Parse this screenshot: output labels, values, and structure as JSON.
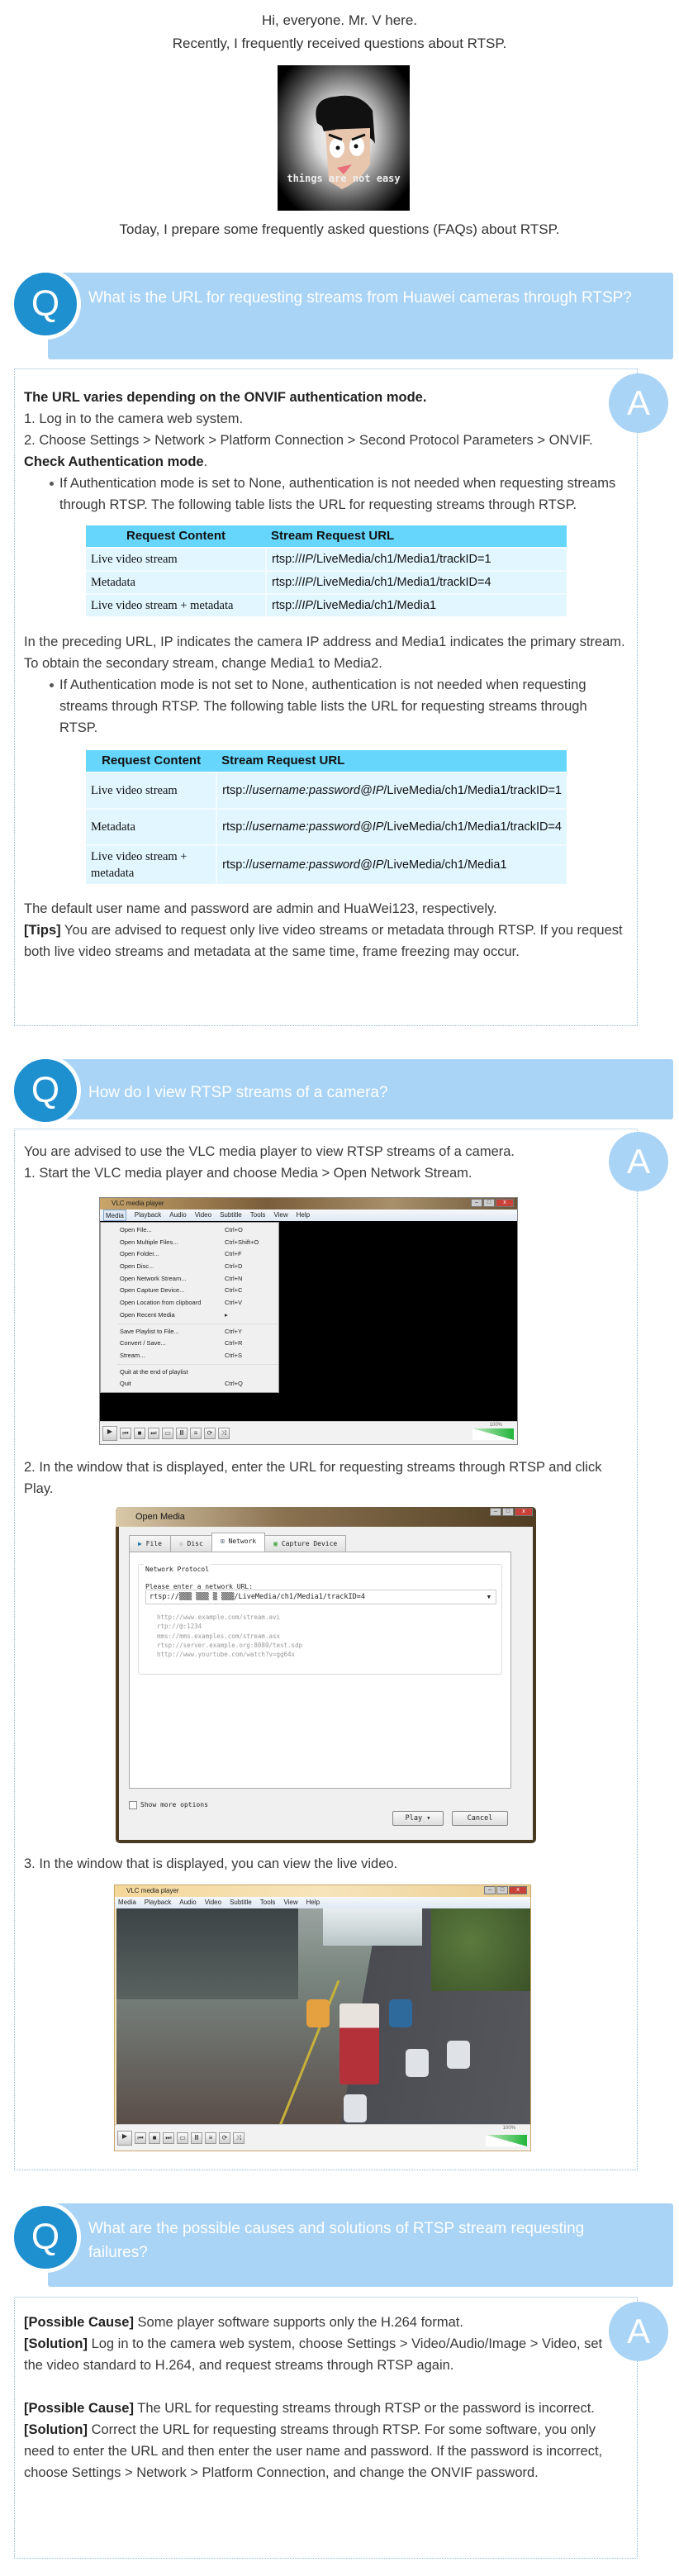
{
  "intro": {
    "line1": "Hi, everyone. Mr. V here.",
    "line2": "Recently, I frequently received questions about RTSP.",
    "image_caption": "things are not easy",
    "line3": "Today, I prepare some frequently asked questions (FAQs) about RTSP."
  },
  "badges": {
    "q": "Q",
    "a": "A"
  },
  "colors": {
    "question_bar": "#a9d4f6",
    "q_circle": "#1e8fcf",
    "a_circle": "#a9d4f6",
    "table_header": "#66d6fc",
    "table_row": "#e1f6fe"
  },
  "faq1": {
    "question": "What is the URL for requesting streams from Huawei cameras through RTSP?",
    "intro_bold": "The URL varies depending on the ONVIF authentication mode.",
    "step1": "1. Log in to the camera web system.",
    "step2_text": "2. Choose Settings > Network > Platform Connection > Second Protocol Parameters > ONVIF. ",
    "step2_bold": "Check Authentication mode",
    "step2_end": ".",
    "bullet1": "If Authentication mode is set to None, authentication is not needed when requesting streams through RTSP. The following table lists the URL for requesting streams through RTSP.",
    "table1": {
      "headers": [
        "Request Content",
        "Stream Request URL"
      ],
      "rows": [
        {
          "content": "Live video stream",
          "url_pre": "rtsp://",
          "url_var": "IP",
          "url_post": "/LiveMedia/ch1/Media1/trackID=1"
        },
        {
          "content": "Metadata",
          "url_pre": "rtsp://",
          "url_var": "IP",
          "url_post": "/LiveMedia/ch1/Media1/trackID=4"
        },
        {
          "content": "Live video stream + metadata",
          "url_pre": "rtsp://",
          "url_var": "IP",
          "url_post": "/LiveMedia/ch1/Media1"
        }
      ]
    },
    "note": "In the preceding URL, IP indicates the camera IP address and Media1 indicates the primary stream. To obtain the secondary stream, change Media1 to Media2.",
    "bullet2": "If Authentication mode is not set to None, authentication is not needed when requesting streams through RTSP. The following table lists the URL for requesting streams through RTSP.",
    "table2": {
      "headers": [
        "Request Content",
        "Stream Request URL"
      ],
      "rows": [
        {
          "content": "Live video stream",
          "url_pre": "rtsp://",
          "url_var": "username:password@IP",
          "url_post": "/LiveMedia/ch1/Media1/trackID=1"
        },
        {
          "content": "Metadata",
          "url_pre": "rtsp://",
          "url_var": "username:password@IP",
          "url_post": "/LiveMedia/ch1/Media1/trackID=4"
        },
        {
          "content": "Live video stream + metadata",
          "url_pre": "rtsp://",
          "url_var": "username:password@IP",
          "url_post": "/LiveMedia/ch1/Media1"
        }
      ]
    },
    "default_creds": "The default user name and password are admin and HuaWei123, respectively.",
    "tips_label": "[Tips]",
    "tips_text": " You are advised to request only live video streams or metadata through RTSP. If you request both live video streams and metadata at the same time, frame freezing may occur."
  },
  "faq2": {
    "question": "How do I view RTSP streams of a camera?",
    "intro": "You are advised to use the VLC media player to view RTSP streams of a camera.",
    "step1": "1. Start the VLC media player and choose Media > Open Network Stream.",
    "step2": "2. In the window that is displayed, enter the URL for requesting streams through RTSP and click Play.",
    "step3": "3. In the window that is displayed, you can view the live video.",
    "vlc": {
      "title": "VLC media player",
      "menus": [
        "Media",
        "Playback",
        "Audio",
        "Video",
        "Subtitle",
        "Tools",
        "View",
        "Help"
      ],
      "media_menu": [
        {
          "label": "Open File...",
          "shortcut": "Ctrl+O"
        },
        {
          "label": "Open Multiple Files...",
          "shortcut": "Ctrl+Shift+O"
        },
        {
          "label": "Open Folder...",
          "shortcut": "Ctrl+F"
        },
        {
          "label": "Open Disc...",
          "shortcut": "Ctrl+D"
        },
        {
          "label": "Open Network Stream...",
          "shortcut": "Ctrl+N"
        },
        {
          "label": "Open Capture Device...",
          "shortcut": "Ctrl+C"
        },
        {
          "label": "Open Location from clipboard",
          "shortcut": "Ctrl+V"
        },
        {
          "label": "Open Recent Media",
          "shortcut": "▸"
        },
        {
          "label": "Save Playlist to File...",
          "shortcut": "Ctrl+Y"
        },
        {
          "label": "Convert / Save...",
          "shortcut": "Ctrl+R"
        },
        {
          "label": "Stream...",
          "shortcut": "Ctrl+S"
        },
        {
          "label": "Quit at the end of playlist",
          "shortcut": ""
        },
        {
          "label": "Quit",
          "shortcut": "Ctrl+Q"
        }
      ],
      "volume": "100%"
    },
    "open_media": {
      "title": "Open Media",
      "tabs": [
        "File",
        "Disc",
        "Network",
        "Capture Device"
      ],
      "active_tab": "Network",
      "group_label": "Network Protocol",
      "prompt": "Please enter a network URL:",
      "url_value": "rtsp://▒▒▒ ▒▒▒ ▒ ▒▒▒/LiveMedia/ch1/Media1/trackID=4",
      "examples": [
        "http://www.example.com/stream.avi",
        "rtp://@:1234",
        "mms://mms.examples.com/stream.asx",
        "rtsp://server.example.org:8080/test.sdp",
        "http://www.yourtube.com/watch?v=gg64x"
      ],
      "show_more": "Show more options",
      "play": "Play",
      "cancel": "Cancel"
    }
  },
  "faq3": {
    "question": "What are the possible causes and solutions of RTSP stream requesting failures?",
    "cause_label": "[Possible Cause]",
    "solution_label": "[Solution]",
    "cause1": " Some player software supports only the H.264 format.",
    "solution1": " Log in to the camera web system, choose Settings > Video/Audio/Image > Video, set the video standard to H.264, and request streams through RTSP again.",
    "cause2": " The URL for requesting streams through RTSP or the password is incorrect.",
    "solution2": " Correct the URL for requesting streams through RTSP. For some software, you only need to enter the URL and then enter the user name and password. If the password is incorrect, choose Settings > Network > Platform Connection, and change the ONVIF password."
  }
}
